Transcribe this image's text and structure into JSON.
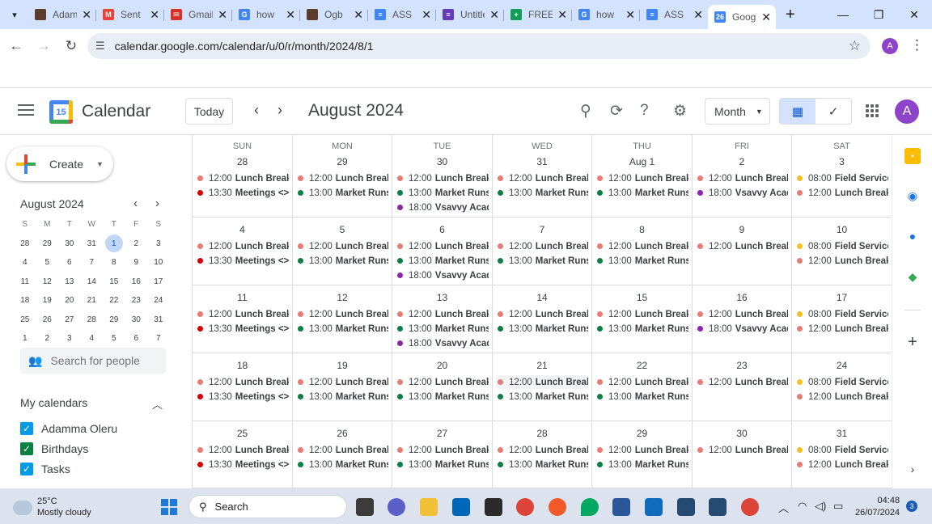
{
  "browser": {
    "tabs": [
      {
        "title": "Adamma",
        "favicon": "trello-icon",
        "color": "#5c3d2e",
        "glyph": ""
      },
      {
        "title": "Sent",
        "favicon": "gmail-icon",
        "color": "#ea4335",
        "glyph": "M"
      },
      {
        "title": "Gmail",
        "favicon": "mail-icon",
        "color": "#d93025",
        "glyph": "✉"
      },
      {
        "title": "how",
        "favicon": "google-icon",
        "color": "#4285f4",
        "glyph": "G"
      },
      {
        "title": "Ogb",
        "favicon": "trello-icon",
        "color": "#5c3d2e",
        "glyph": ""
      },
      {
        "title": "ASS",
        "favicon": "docs-icon",
        "color": "#4285f4",
        "glyph": "≡"
      },
      {
        "title": "Untitled",
        "favicon": "forms-icon",
        "color": "#673ab7",
        "glyph": "≡"
      },
      {
        "title": "FREE",
        "favicon": "sheets-icon",
        "color": "#0f9d58",
        "glyph": "+"
      },
      {
        "title": "how",
        "favicon": "google-icon",
        "color": "#4285f4",
        "glyph": "G"
      },
      {
        "title": "ASS",
        "favicon": "docs-icon",
        "color": "#4285f4",
        "glyph": "≡"
      },
      {
        "title": "Google",
        "favicon": "calendar-icon",
        "color": "#4285f4",
        "glyph": "26"
      }
    ],
    "url": "calendar.google.com/calendar/u/0/r/month/2024/8/1",
    "profile_initial": "A"
  },
  "header": {
    "app_title": "Calendar",
    "logo_day": "15",
    "today_label": "Today",
    "month_title": "August 2024",
    "view_label": "Month",
    "avatar_initial": "A"
  },
  "sidebar": {
    "create_label": "Create",
    "mini_title": "August 2024",
    "mini_dow": [
      "S",
      "M",
      "T",
      "W",
      "T",
      "F",
      "S"
    ],
    "mini_days": [
      "28",
      "29",
      "30",
      "31",
      "1",
      "2",
      "3",
      "4",
      "5",
      "6",
      "7",
      "8",
      "9",
      "10",
      "11",
      "12",
      "13",
      "14",
      "15",
      "16",
      "17",
      "18",
      "19",
      "20",
      "21",
      "22",
      "23",
      "24",
      "25",
      "26",
      "27",
      "28",
      "29",
      "30",
      "31",
      "1",
      "2",
      "3",
      "4",
      "5",
      "6",
      "7"
    ],
    "mini_selected_index": 4,
    "search_people": "Search for people",
    "my_calendars_label": "My calendars",
    "calendars": [
      {
        "name": "Adamma Oleru",
        "color": "#039be5"
      },
      {
        "name": "Birthdays",
        "color": "#0b8043"
      },
      {
        "name": "Tasks",
        "color": "#039be5"
      }
    ]
  },
  "calendar": {
    "dow": [
      "SUN",
      "MON",
      "TUE",
      "WED",
      "THU",
      "FRI",
      "SAT"
    ],
    "colors": {
      "lunch": "#e67c73",
      "meetings": "#d50000",
      "market": "#0b8043",
      "vsavvy": "#8e24aa",
      "field": "#f6bf26"
    },
    "weeks": [
      [
        {
          "day": "28",
          "events": [
            {
              "time": "12:00",
              "name": "Lunch Break.",
              "cat": "lunch"
            },
            {
              "time": "13:30",
              "name": "Meetings <> Hi",
              "cat": "meetings"
            }
          ]
        },
        {
          "day": "29",
          "events": [
            {
              "time": "12:00",
              "name": "Lunch Break.",
              "cat": "lunch"
            },
            {
              "time": "13:00",
              "name": "Market Runs.",
              "cat": "market"
            }
          ]
        },
        {
          "day": "30",
          "events": [
            {
              "time": "12:00",
              "name": "Lunch Break.",
              "cat": "lunch"
            },
            {
              "time": "13:00",
              "name": "Market Runs.",
              "cat": "market"
            },
            {
              "time": "18:00",
              "name": "Vsavvy Academy",
              "cat": "vsavvy"
            }
          ]
        },
        {
          "day": "31",
          "events": [
            {
              "time": "12:00",
              "name": "Lunch Break.",
              "cat": "lunch"
            },
            {
              "time": "13:00",
              "name": "Market Runs.",
              "cat": "market"
            }
          ]
        },
        {
          "day": "Aug 1",
          "events": [
            {
              "time": "12:00",
              "name": "Lunch Break.",
              "cat": "lunch"
            },
            {
              "time": "13:00",
              "name": "Market Runs.",
              "cat": "market"
            }
          ]
        },
        {
          "day": "2",
          "events": [
            {
              "time": "12:00",
              "name": "Lunch Break.",
              "cat": "lunch"
            },
            {
              "time": "18:00",
              "name": "Vsavvy Academy",
              "cat": "vsavvy"
            }
          ]
        },
        {
          "day": "3",
          "events": [
            {
              "time": "08:00",
              "name": "Field Service",
              "cat": "field"
            },
            {
              "time": "12:00",
              "name": "Lunch Break.",
              "cat": "lunch"
            }
          ]
        }
      ],
      [
        {
          "day": "4",
          "events": [
            {
              "time": "12:00",
              "name": "Lunch Break.",
              "cat": "lunch"
            },
            {
              "time": "13:30",
              "name": "Meetings <> Hi",
              "cat": "meetings"
            }
          ]
        },
        {
          "day": "5",
          "events": [
            {
              "time": "12:00",
              "name": "Lunch Break.",
              "cat": "lunch"
            },
            {
              "time": "13:00",
              "name": "Market Runs.",
              "cat": "market"
            }
          ]
        },
        {
          "day": "6",
          "events": [
            {
              "time": "12:00",
              "name": "Lunch Break.",
              "cat": "lunch"
            },
            {
              "time": "13:00",
              "name": "Market Runs.",
              "cat": "market"
            },
            {
              "time": "18:00",
              "name": "Vsavvy Academy",
              "cat": "vsavvy"
            }
          ]
        },
        {
          "day": "7",
          "events": [
            {
              "time": "12:00",
              "name": "Lunch Break.",
              "cat": "lunch"
            },
            {
              "time": "13:00",
              "name": "Market Runs.",
              "cat": "market"
            }
          ]
        },
        {
          "day": "8",
          "events": [
            {
              "time": "12:00",
              "name": "Lunch Break.",
              "cat": "lunch"
            },
            {
              "time": "13:00",
              "name": "Market Runs.",
              "cat": "market"
            }
          ]
        },
        {
          "day": "9",
          "events": [
            {
              "time": "12:00",
              "name": "Lunch Break.",
              "cat": "lunch"
            }
          ]
        },
        {
          "day": "10",
          "events": [
            {
              "time": "08:00",
              "name": "Field Service",
              "cat": "field"
            },
            {
              "time": "12:00",
              "name": "Lunch Break.",
              "cat": "lunch"
            }
          ]
        }
      ],
      [
        {
          "day": "11",
          "events": [
            {
              "time": "12:00",
              "name": "Lunch Break.",
              "cat": "lunch"
            },
            {
              "time": "13:30",
              "name": "Meetings <> Hi",
              "cat": "meetings"
            }
          ]
        },
        {
          "day": "12",
          "events": [
            {
              "time": "12:00",
              "name": "Lunch Break.",
              "cat": "lunch"
            },
            {
              "time": "13:00",
              "name": "Market Runs.",
              "cat": "market"
            }
          ]
        },
        {
          "day": "13",
          "events": [
            {
              "time": "12:00",
              "name": "Lunch Break.",
              "cat": "lunch"
            },
            {
              "time": "13:00",
              "name": "Market Runs.",
              "cat": "market"
            },
            {
              "time": "18:00",
              "name": "Vsavvy Academy",
              "cat": "vsavvy"
            }
          ]
        },
        {
          "day": "14",
          "events": [
            {
              "time": "12:00",
              "name": "Lunch Break.",
              "cat": "lunch"
            },
            {
              "time": "13:00",
              "name": "Market Runs.",
              "cat": "market"
            }
          ]
        },
        {
          "day": "15",
          "events": [
            {
              "time": "12:00",
              "name": "Lunch Break.",
              "cat": "lunch"
            },
            {
              "time": "13:00",
              "name": "Market Runs.",
              "cat": "market"
            }
          ]
        },
        {
          "day": "16",
          "events": [
            {
              "time": "12:00",
              "name": "Lunch Break.",
              "cat": "lunch"
            },
            {
              "time": "18:00",
              "name": "Vsavvy Academy",
              "cat": "vsavvy"
            }
          ]
        },
        {
          "day": "17",
          "events": [
            {
              "time": "08:00",
              "name": "Field Service",
              "cat": "field"
            },
            {
              "time": "12:00",
              "name": "Lunch Break.",
              "cat": "lunch"
            }
          ]
        }
      ],
      [
        {
          "day": "18",
          "events": [
            {
              "time": "12:00",
              "name": "Lunch Break.",
              "cat": "lunch"
            },
            {
              "time": "13:30",
              "name": "Meetings <> Hi",
              "cat": "meetings"
            }
          ]
        },
        {
          "day": "19",
          "events": [
            {
              "time": "12:00",
              "name": "Lunch Break.",
              "cat": "lunch"
            },
            {
              "time": "13:00",
              "name": "Market Runs.",
              "cat": "market"
            }
          ]
        },
        {
          "day": "20",
          "events": [
            {
              "time": "12:00",
              "name": "Lunch Break.",
              "cat": "lunch"
            },
            {
              "time": "13:00",
              "name": "Market Runs.",
              "cat": "market"
            }
          ]
        },
        {
          "day": "21",
          "events": [
            {
              "time": "12:00",
              "name": "Lunch Break.",
              "cat": "lunch",
              "hover": true
            },
            {
              "time": "13:00",
              "name": "Market Runs.",
              "cat": "market"
            }
          ]
        },
        {
          "day": "22",
          "events": [
            {
              "time": "12:00",
              "name": "Lunch Break.",
              "cat": "lunch"
            },
            {
              "time": "13:00",
              "name": "Market Runs.",
              "cat": "market"
            }
          ]
        },
        {
          "day": "23",
          "events": [
            {
              "time": "12:00",
              "name": "Lunch Break.",
              "cat": "lunch"
            }
          ]
        },
        {
          "day": "24",
          "events": [
            {
              "time": "08:00",
              "name": "Field Service",
              "cat": "field"
            },
            {
              "time": "12:00",
              "name": "Lunch Break.",
              "cat": "lunch"
            }
          ]
        }
      ],
      [
        {
          "day": "25",
          "events": [
            {
              "time": "12:00",
              "name": "Lunch Break.",
              "cat": "lunch"
            },
            {
              "time": "13:30",
              "name": "Meetings <> Hi",
              "cat": "meetings"
            }
          ]
        },
        {
          "day": "26",
          "events": [
            {
              "time": "12:00",
              "name": "Lunch Break.",
              "cat": "lunch"
            },
            {
              "time": "13:00",
              "name": "Market Runs.",
              "cat": "market"
            }
          ]
        },
        {
          "day": "27",
          "events": [
            {
              "time": "12:00",
              "name": "Lunch Break.",
              "cat": "lunch"
            },
            {
              "time": "13:00",
              "name": "Market Runs.",
              "cat": "market"
            }
          ]
        },
        {
          "day": "28",
          "events": [
            {
              "time": "12:00",
              "name": "Lunch Break.",
              "cat": "lunch"
            },
            {
              "time": "13:00",
              "name": "Market Runs.",
              "cat": "market"
            }
          ]
        },
        {
          "day": "29",
          "events": [
            {
              "time": "12:00",
              "name": "Lunch Break.",
              "cat": "lunch"
            },
            {
              "time": "13:00",
              "name": "Market Runs.",
              "cat": "market"
            }
          ]
        },
        {
          "day": "30",
          "events": [
            {
              "time": "12:00",
              "name": "Lunch Break.",
              "cat": "lunch"
            }
          ]
        },
        {
          "day": "31",
          "events": [
            {
              "time": "08:00",
              "name": "Field Service",
              "cat": "field"
            },
            {
              "time": "12:00",
              "name": "Lunch Break.",
              "cat": "lunch"
            }
          ]
        }
      ]
    ]
  },
  "taskbar": {
    "temperature": "25°C",
    "weather": "Mostly cloudy",
    "search_label": "Search",
    "time": "04:48",
    "date": "26/07/2024",
    "notifications": "3"
  }
}
